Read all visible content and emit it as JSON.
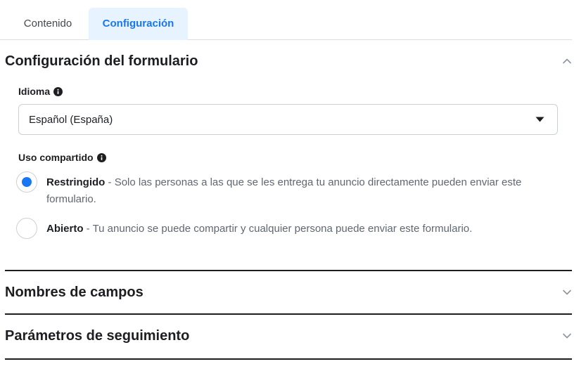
{
  "tabs": [
    {
      "label": "Contenido",
      "active": false
    },
    {
      "label": "Configuración",
      "active": true
    }
  ],
  "form_settings": {
    "title": "Configuración del formulario",
    "expanded": true,
    "language": {
      "label": "Idioma",
      "selected": "Español (España)"
    },
    "sharing": {
      "label": "Uso compartido",
      "options": [
        {
          "name": "Restringido",
          "separator": " - ",
          "description": "Solo las personas a las que se les entrega tu anuncio directamente pueden enviar este formulario.",
          "selected": true
        },
        {
          "name": "Abierto",
          "separator": " - ",
          "description": "Tu anuncio se puede compartir y cualquier persona puede enviar este formulario.",
          "selected": false
        }
      ]
    }
  },
  "sections": [
    {
      "title": "Nombres de campos",
      "expanded": false
    },
    {
      "title": "Parámetros de seguimiento",
      "expanded": false
    }
  ],
  "icons": {
    "info": "info-icon",
    "collapse": "chevron-up-icon",
    "expand": "chevron-down-icon",
    "dropdown": "caret-down-icon"
  },
  "colors": {
    "accent": "#1877f2",
    "active_tab_bg": "#e7f3ff",
    "text": "#1c1e21",
    "muted": "#606770"
  }
}
